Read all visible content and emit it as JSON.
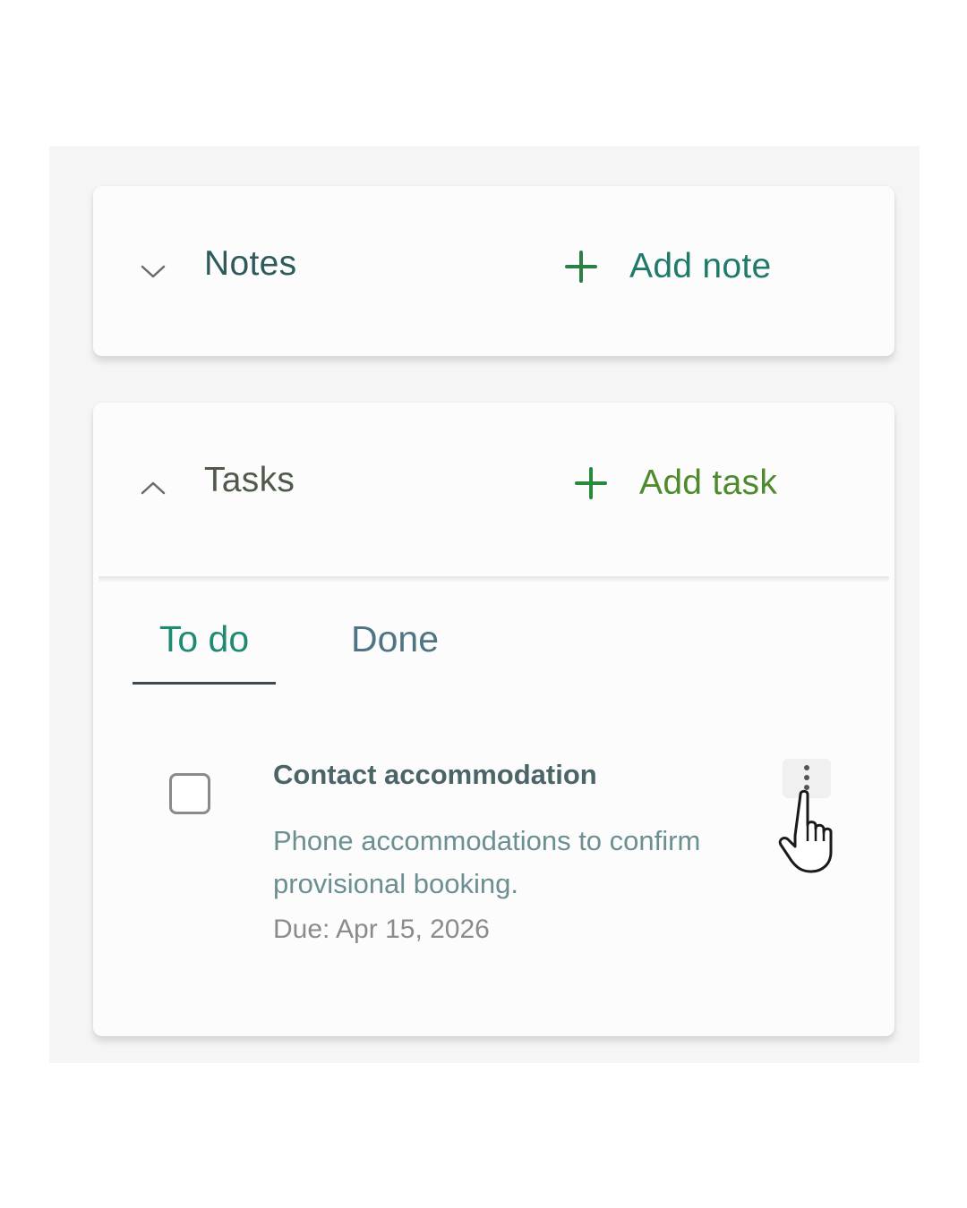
{
  "notes": {
    "title": "Notes",
    "add_label": "Add note",
    "chevron_icon": "chevron-down-icon",
    "plus_icon": "plus-icon"
  },
  "tasks": {
    "title": "Tasks",
    "add_label": "Add task",
    "chevron_icon": "chevron-up-icon",
    "plus_icon": "plus-icon",
    "tabs": [
      {
        "label": "To do",
        "active": true
      },
      {
        "label": "Done",
        "active": false
      }
    ],
    "items": [
      {
        "title": "Contact accommodation",
        "description": "Phone accommodations to confirm provisional booking.",
        "due": "Due: Apr 15, 2026",
        "checked": false,
        "menu_icon": "more-vertical-icon"
      }
    ]
  },
  "cursor_icon": "hand-pointer-icon",
  "colors": {
    "accent_green": "#1f7a6a",
    "tab_active": "#1e8a72",
    "background": "#f5f5f5",
    "card": "#fcfcfc"
  }
}
